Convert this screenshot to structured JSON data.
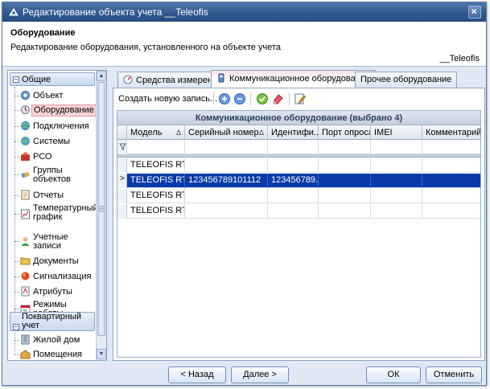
{
  "window": {
    "title": "Редактирование объекта учета __Teleofis"
  },
  "header": {
    "title": "Оборудование",
    "subtitle": "Редактирование оборудования, установленного на объекте учета",
    "object_name": "__Teleofis"
  },
  "nav": {
    "groups": [
      {
        "label": "Общие",
        "toggle": "–",
        "items": [
          {
            "label": "Объект",
            "icon": "object-icon"
          },
          {
            "label": "Оборудование",
            "icon": "equipment-icon",
            "selected": true
          },
          {
            "label": "Подключения",
            "icon": "connections-icon"
          },
          {
            "label": "Системы",
            "icon": "systems-icon"
          },
          {
            "label": "РСО",
            "icon": "rso-icon"
          },
          {
            "label": "Группы объектов",
            "icon": "object-groups-icon"
          },
          {
            "label": "Отчеты",
            "icon": "reports-icon"
          },
          {
            "label": "Температурный график",
            "icon": "temperature-chart-icon"
          },
          {
            "label": "Учетные записи",
            "icon": "accounts-icon"
          },
          {
            "label": "Документы",
            "icon": "documents-icon"
          },
          {
            "label": "Сигнализация",
            "icon": "alarm-icon"
          },
          {
            "label": "Атрибуты",
            "icon": "attributes-icon"
          },
          {
            "label": "Режимы работы",
            "icon": "work-modes-icon"
          }
        ]
      },
      {
        "label": "Поквартирный учет",
        "toggle": "–",
        "items": [
          {
            "label": "Жилой дом",
            "icon": "house-icon"
          },
          {
            "label": "Помещения",
            "icon": "rooms-icon"
          }
        ]
      }
    ]
  },
  "tabs": [
    {
      "label": "Средства измерения",
      "icon": "meter-icon"
    },
    {
      "label": "Коммуникационное оборудование",
      "icon": "modem-icon",
      "active": true
    },
    {
      "label": "Прочее оборудование"
    }
  ],
  "toolbar": {
    "create_label": "Создать новую запись..."
  },
  "grid": {
    "group_title": "Коммуникационное оборудование (выбрано 4)",
    "columns": [
      {
        "label": "Модель",
        "sort": "Δ"
      },
      {
        "label": "Серийный номер",
        "sort": "Δ"
      },
      {
        "label": "Идентифи...",
        "sort": ""
      },
      {
        "label": "Порт опроса",
        "sort": ""
      },
      {
        "label": "IMEI",
        "sort": ""
      },
      {
        "label": "Комментарий",
        "sort": ""
      }
    ],
    "rows": [
      {
        "model": "TELEOFIS RT...",
        "serial": "",
        "ident": "",
        "port": "",
        "imei": "",
        "comment": "",
        "selected": false
      },
      {
        "model": "TELEOFIS RT...",
        "serial": "123456789101112",
        "ident": "123456789...",
        "port": "",
        "imei": "",
        "comment": "",
        "selected": true
      },
      {
        "model": "TELEOFIS RT...",
        "serial": "",
        "ident": "",
        "port": "",
        "imei": "",
        "comment": "",
        "selected": false
      },
      {
        "model": "TELEOFIS RT...",
        "serial": "",
        "ident": "",
        "port": "",
        "imei": "",
        "comment": "",
        "selected": false
      }
    ],
    "current_row_marker": ">"
  },
  "buttons": {
    "back": "< Назад",
    "next": "Далее >",
    "ok": "ОК",
    "cancel": "Отменить"
  },
  "colors": {
    "selection": "#0a3aa8",
    "nav_selected": "#f6d3d6",
    "titlebar": "#2f5a8f"
  }
}
